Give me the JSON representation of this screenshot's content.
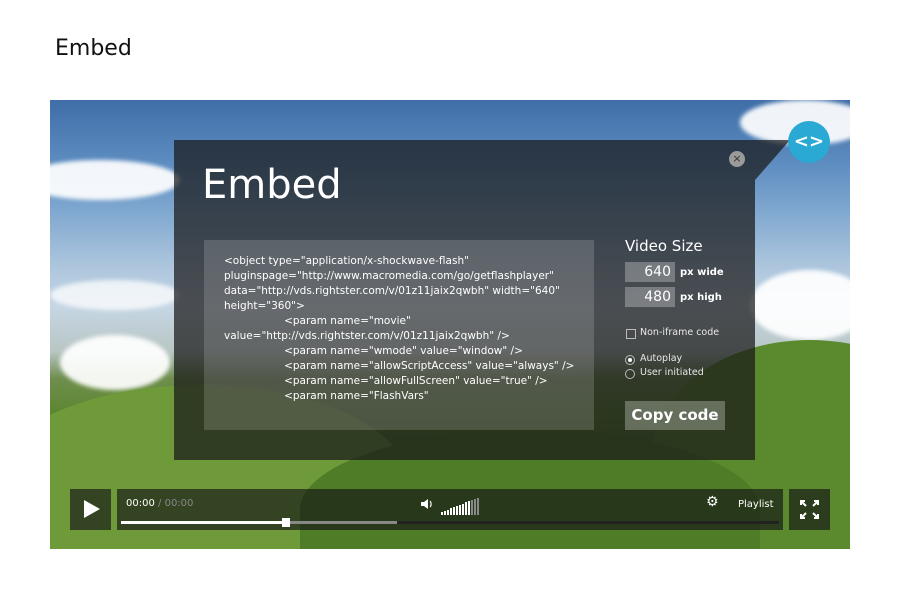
{
  "page": {
    "heading": "Embed"
  },
  "embed_panel": {
    "title": "Embed",
    "close_symbol": "×",
    "toggle_symbol": "<>",
    "code": "<object type=\"application/x-shockwave-flash\"\npluginspage=\"http://www.macromedia.com/go/getflashplayer\"\ndata=\"http://vds.rightster.com/v/01z11jaix2qwbh\" width=\"640\"\nheight=\"360\">\n                  <param name=\"movie\"\nvalue=\"http://vds.rightster.com/v/01z11jaix2qwbh\" />\n                  <param name=\"wmode\" value=\"window\" />\n                  <param name=\"allowScriptAccess\" value=\"always\" />\n                  <param name=\"allowFullScreen\" value=\"true\" />\n                  <param name=\"FlashVars\"",
    "video_size_label": "Video Size",
    "width_value": "640",
    "width_unit": "px wide",
    "height_value": "480",
    "height_unit": "px high",
    "non_iframe_label": "Non-iframe code",
    "non_iframe_checked": false,
    "autoplay_label": "Autoplay",
    "user_initiated_label": "User initiated",
    "selected_play_mode": "Autoplay",
    "copy_button_label": "Copy code",
    "accent_color": "#29a9d3"
  },
  "player": {
    "current_time": "00:00",
    "separator": "/",
    "duration": "00:00",
    "playlist_label": "Playlist",
    "progress_fraction": 0.25,
    "buffered_fraction": 0.42,
    "icons": [
      "play-icon",
      "volume-icon",
      "gear-icon",
      "fullscreen-icon"
    ]
  }
}
